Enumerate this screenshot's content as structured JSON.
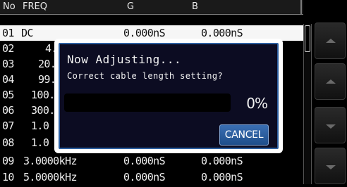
{
  "table": {
    "headers": {
      "no": "No",
      "freq": "FREQ",
      "g": "G",
      "b": "B"
    },
    "rows": [
      {
        "no": "01",
        "freq": "DC",
        "g": "0.000nS",
        "b": "0.000nS",
        "selected": true
      },
      {
        "no": "02",
        "freq": "4.",
        "g": "",
        "b": ""
      },
      {
        "no": "03",
        "freq": "20.",
        "g": "",
        "b": ""
      },
      {
        "no": "04",
        "freq": "99.",
        "g": "",
        "b": ""
      },
      {
        "no": "05",
        "freq": "100.",
        "g": "",
        "b": ""
      },
      {
        "no": "06",
        "freq": "300.",
        "g": "",
        "b": ""
      },
      {
        "no": "07",
        "freq": "1.0",
        "g": "",
        "b": ""
      },
      {
        "no": "08",
        "freq": "1.0",
        "g": "",
        "b": ""
      },
      {
        "no": "09",
        "freq": "3.0000kHz",
        "g": "0.000nS",
        "b": "0.000nS"
      },
      {
        "no": "10",
        "freq": "5.0000kHz",
        "g": "0.000nS",
        "b": "0.000nS"
      }
    ]
  },
  "dialog": {
    "title": "Now Adjusting...",
    "message": "Correct cable length setting?",
    "progress_value": 0,
    "progress_label": "0%",
    "cancel_label": "CANCEL"
  },
  "side_panel": {
    "buttons": [
      {
        "icon": "chevron-up-icon",
        "direction": "up"
      },
      {
        "icon": "chevron-up-icon",
        "direction": "up"
      },
      {
        "icon": "chevron-down-icon",
        "direction": "down"
      },
      {
        "icon": "chevron-down-icon",
        "direction": "down"
      }
    ]
  },
  "colors": {
    "dialog_background": "#0c0c22",
    "dialog_border": "#2d5fa0",
    "cancel_button": "#2d5fa0",
    "selected_row": "#f6f6f6"
  }
}
